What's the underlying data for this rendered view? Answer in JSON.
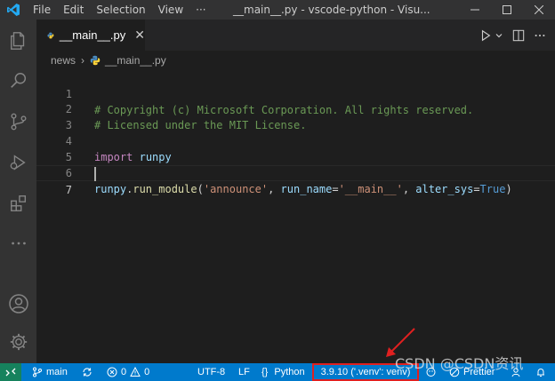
{
  "titlebar": {
    "menu": [
      "File",
      "Edit",
      "Selection",
      "View",
      "···"
    ],
    "title": "__main__.py - vscode-python - Visu..."
  },
  "activitybar": {
    "icons": [
      "files-icon",
      "search-icon",
      "source-control-icon",
      "run-debug-icon",
      "extensions-icon",
      "more-icon",
      "account-icon",
      "settings-gear-icon"
    ]
  },
  "tab": {
    "label": "__main__.py",
    "close": "✕"
  },
  "breadcrumb": {
    "folder": "news",
    "file": "__main__.py"
  },
  "editor": {
    "line_numbers": [
      "1",
      "2",
      "3",
      "4",
      "5",
      "6",
      "7"
    ],
    "line1": "# Copyright (c) Microsoft Corporation. All rights reserved.",
    "line2": "# Licensed under the MIT License.",
    "line4_keyword": "import",
    "line4_module": "runpy",
    "line6": {
      "obj": "runpy",
      "dot": ".",
      "func": "run_module",
      "open": "(",
      "arg1": "'announce'",
      "comma1": ", ",
      "kw1": "run_name",
      "eq1": "=",
      "arg2": "'__main__'",
      "comma2": ", ",
      "kw2": "alter_sys",
      "eq2": "=",
      "val": "True",
      "close": ")"
    }
  },
  "statusbar": {
    "branch": "main",
    "errors": "0",
    "warnings": "0",
    "encoding": "UTF-8",
    "eol": "LF",
    "lang_braces": "{}",
    "language": "Python",
    "interpreter": "3.9.10 ('.venv': venv)",
    "prettier": "Prettier"
  },
  "watermark": "CSDN @CSDN资讯",
  "colors": {
    "statusbar": "#007acc",
    "remote": "#16825d",
    "highlight_box": "#e02020",
    "logo": "#23a9f2"
  }
}
